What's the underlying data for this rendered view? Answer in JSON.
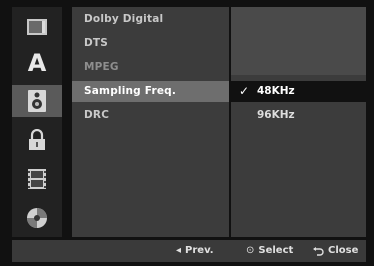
{
  "sidebar": {
    "icons": [
      {
        "name": "display-icon"
      },
      {
        "name": "language-icon",
        "glyph": "A"
      },
      {
        "name": "audio-icon"
      },
      {
        "name": "lock-icon"
      },
      {
        "name": "film-icon"
      },
      {
        "name": "disc-icon"
      }
    ],
    "selected_index": 2
  },
  "menu": {
    "items": [
      {
        "label": "Dolby Digital"
      },
      {
        "label": "DTS"
      },
      {
        "label": "MPEG"
      },
      {
        "label": "Sampling Freq."
      },
      {
        "label": "DRC"
      }
    ],
    "selected_index": 3
  },
  "options": {
    "items": [
      {
        "label": "48KHz",
        "checked": true
      },
      {
        "label": "96KHz",
        "checked": false
      }
    ],
    "check_glyph": "✓"
  },
  "footer": {
    "prev_glyph": "◂",
    "prev_label": "Prev.",
    "select_glyph": "⊙",
    "select_label": "Select",
    "close_glyph": "ꟷ",
    "close_label": "Close"
  },
  "colors": {
    "selected_icon_bg": "#5a5a5a",
    "selected_menu_bg": "#6e6e6e",
    "selected_option_bg": "#111111",
    "panel_bg": "#3c3c3c"
  }
}
